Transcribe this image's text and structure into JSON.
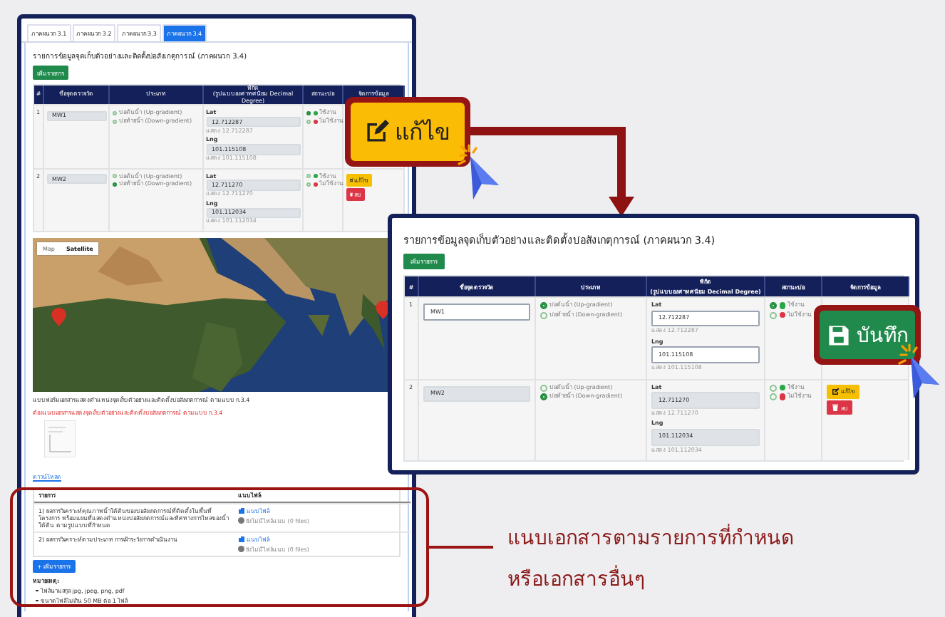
{
  "tabs": [
    {
      "label": "ภาคผนวก 3.1",
      "selected": false
    },
    {
      "label": "ภาคผนวก 3.2",
      "selected": false
    },
    {
      "label": "ภาคผนวก 3.3",
      "selected": false
    },
    {
      "label": "ภาคผนวก 3.4",
      "selected": true
    }
  ],
  "left_page": {
    "title": "รายการข้อมูลจุดเก็บตัวอย่างและติดตั้งบ่อสังเกตุการณ์ (ภาคผนวก 3.4)",
    "add_button": "เพิ่มรายการ",
    "table": {
      "columns": [
        "#",
        "ชื่อจุดตรวจวัด",
        "ประเภท",
        "พิกัด\n(รูปแบบองศาทศนิยม Decimal Degree)",
        "สถานะบ่อ",
        "จัดการข้อมูล"
      ],
      "rows": [
        {
          "no": "1",
          "name": "MW1",
          "editable": false,
          "types": [
            {
              "label": "บ่อต้นน้ำ (Up-gradient)",
              "selected": false
            },
            {
              "label": "บ่อท้ายน้ำ (Down-gradient)",
              "selected": false
            }
          ],
          "lat_label": "Lat",
          "lat": "12.712287",
          "lat_note": "แสดง 12.712287",
          "lng_label": "Lng",
          "lng": "101.115108",
          "lng_note": "แสดง 101.115108",
          "statuses": [
            {
              "label": "ใช้งาน",
              "selected": true,
              "color": "#28a745"
            },
            {
              "label": "ไม่ใช้งาน",
              "selected": false,
              "color": "#dc3545"
            }
          ]
        },
        {
          "no": "2",
          "name": "MW2",
          "editable": false,
          "types": [
            {
              "label": "บ่อต้นน้ำ (Up-gradient)",
              "selected": false
            },
            {
              "label": "บ่อท้ายน้ำ (Down-gradient)",
              "selected": true
            }
          ],
          "lat_label": "Lat",
          "lat": "12.711270",
          "lat_note": "แสดง 12.711270",
          "lng_label": "Lng",
          "lng": "101.112034",
          "lng_note": "แสดง 101.112034",
          "statuses": [
            {
              "label": "ใช้งาน",
              "selected": false,
              "color": "#28a745"
            },
            {
              "label": "ไม่ใช้งาน",
              "selected": false,
              "color": "#dc3545"
            }
          ],
          "actions": [
            {
              "label": "แก้ไข",
              "kind": "edit"
            },
            {
              "label": "ลบ",
              "kind": "delete"
            }
          ]
        }
      ]
    },
    "map": {
      "buttons": [
        {
          "label": "Map",
          "selected": false
        },
        {
          "label": "Satellite",
          "selected": true
        }
      ]
    },
    "download_text": "แบบฟอร์มเอกสารแสดงตำแหน่งจุดเก็บตัวอย่างและติดตั้งบ่อสังเกตการณ์ ตามแบบ ก.3.4",
    "required_text": "ต้องแนบเอกสารแสดงจุดเก็บตัวอย่างและติดตั้งบ่อสังเกตการณ์ ตามแบบ ก.3.4",
    "download_link": "ดาวน์โหลด",
    "attachments": {
      "columns": [
        "รายการ",
        "แนบไฟล์"
      ],
      "rows": [
        {
          "item": "1) ผลการวิเคราะห์คุณภาพน้ำใต้ดินของบ่อสังเกตการณ์ที่ติดตั้งในพื้นที่โครงการ พร้อมแผนที่แสดงตำแหน่งบ่อสังเกตการณ์และทิศทางการไหลของน้ำใต้ดิน ตามรูปแบบที่กำหนด",
          "link": "แนบไฟล์",
          "status": "ยังไม่มีไฟล์แนบ (0 files)"
        },
        {
          "item": "2) ผลการวิเคราะห์ตามประเภท การเฝ้าระวังการดำเนินงาน",
          "link": "แนบไฟล์",
          "status": "ยังไม่มีไฟล์แนบ (0 files)"
        }
      ],
      "add_button": "+ เพิ่มรายการ",
      "note_title": "หมายเหตุ:",
      "notes": [
        "ไฟล์นามสกุล jpg, jpeg, png, pdf",
        "ขนาดไฟล์ไม่เกิน 50 MB ต่อ 1 ไฟล์"
      ]
    }
  },
  "right_panel": {
    "title": "รายการข้อมูลจุดเก็บตัวอย่างและติดตั้งบ่อสังเกตุการณ์ (ภาคผนวก 3.4)",
    "add_button": "เพิ่มรายการ",
    "table": {
      "columns": [
        "#",
        "ชื่อจุดตรวจวัด",
        "ประเภท",
        "พิกัด\n(รูปแบบองศาทศนิยม Decimal Degree)",
        "สถานะบ่อ",
        "จัดการข้อมูล"
      ],
      "rows": [
        {
          "no": "1",
          "name": "MW1",
          "editable": true,
          "types": [
            {
              "label": "บ่อต้นน้ำ (Up-gradient)",
              "selected": true
            },
            {
              "label": "บ่อท้ายน้ำ (Down-gradient)",
              "selected": false
            }
          ],
          "lat_label": "Lat",
          "lat": "12.712287",
          "lat_note": "แสดง 12.712287",
          "lng_label": "Lng",
          "lng": "101.115108",
          "lng_note": "แสดง 101.115108",
          "statuses": [
            {
              "label": "ใช้งาน",
              "selected": true,
              "color": "#28a745"
            },
            {
              "label": "ไม่ใช้งาน",
              "selected": false,
              "color": "#dc3545"
            }
          ]
        },
        {
          "no": "2",
          "name": "MW2",
          "editable": false,
          "types": [
            {
              "label": "บ่อต้นน้ำ (Up-gradient)",
              "selected": false
            },
            {
              "label": "บ่อท้ายน้ำ (Down-gradient)",
              "selected": true
            }
          ],
          "lat_label": "Lat",
          "lat": "12.711270",
          "lat_note": "แสดง 12.711270",
          "lng_label": "Lng",
          "lng": "101.112034",
          "lng_note": "แสดง 101.112034",
          "statuses": [
            {
              "label": "ใช้งาน",
              "selected": false,
              "color": "#28a745"
            },
            {
              "label": "ไม่ใช้งาน",
              "selected": false,
              "color": "#dc3545"
            }
          ],
          "actions": [
            {
              "label": "แก้ไข",
              "kind": "edit"
            },
            {
              "label": "ลบ",
              "kind": "delete"
            }
          ]
        }
      ]
    }
  },
  "callouts": [
    {
      "label": "แก้ไข",
      "kind": "edit"
    },
    {
      "label": "บันทึก",
      "kind": "save"
    }
  ],
  "annotation": [
    "แนบเอกสารตามรายการที่กำหนด",
    "หรือเอกสารอื่นๆ"
  ]
}
